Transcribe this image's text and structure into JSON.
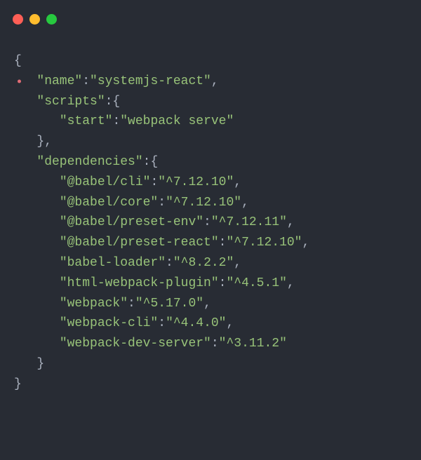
{
  "traffic_lights": {
    "red": "#ff5f56",
    "yellow": "#ffbd2e",
    "green": "#27c93f"
  },
  "code": {
    "l1": "{",
    "l2_key": "\"name\"",
    "l2_sep": ":",
    "l2_val": "\"systemjs-react\"",
    "l2_end": ",",
    "l3_key": "\"scripts\"",
    "l3_sep": ":{",
    "l4_key": "\"start\"",
    "l4_sep": ":",
    "l4_val": "\"webpack serve\"",
    "l5": "},",
    "l6_key": "\"dependencies\"",
    "l6_sep": ":{",
    "l7_key": "\"@babel/cli\"",
    "l7_sep": ":",
    "l7_val": "\"^7.12.10\"",
    "l7_end": ",",
    "l8_key": "\"@babel/core\"",
    "l8_sep": ":",
    "l8_val": "\"^7.12.10\"",
    "l8_end": ",",
    "l9_key": "\"@babel/preset-env\"",
    "l9_sep": ":",
    "l9_val": "\"^7.12.11\"",
    "l9_end": ",",
    "l10_key": "\"@babel/preset-react\"",
    "l10_sep": ":",
    "l10_val": "\"^7.12.10\"",
    "l10_end": ",",
    "l11_key": "\"babel-loader\"",
    "l11_sep": ":",
    "l11_val": "\"^8.2.2\"",
    "l11_end": ",",
    "l12_key": "\"html-webpack-plugin\"",
    "l12_sep": ":",
    "l12_val": "\"^4.5.1\"",
    "l12_end": ",",
    "l13_key": "\"webpack\"",
    "l13_sep": ":",
    "l13_val": "\"^5.17.0\"",
    "l13_end": ",",
    "l14_key": "\"webpack-cli\"",
    "l14_sep": ":",
    "l14_val": "\"^4.4.0\"",
    "l14_end": ",",
    "l15_key": "\"webpack-dev-server\"",
    "l15_sep": ":",
    "l15_val": "\"^3.11.2\"",
    "l16": "}",
    "l17": "}"
  }
}
